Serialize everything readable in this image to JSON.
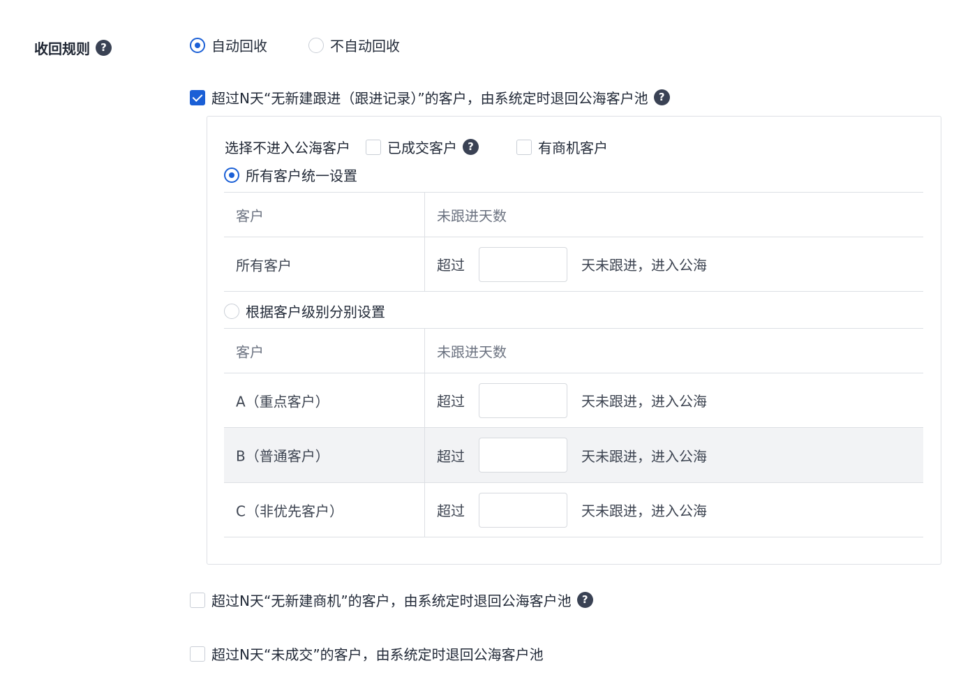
{
  "section": {
    "title": "收回规则",
    "help_icon": "question-circle-icon"
  },
  "recovery_mode": {
    "options": [
      {
        "label": "自动回收",
        "selected": true
      },
      {
        "label": "不自动回收",
        "selected": false
      }
    ]
  },
  "rule_followup": {
    "checked": true,
    "label": "超过N天“无新建跟进（跟进记录）”的客户，由系统定时退回公海客户池",
    "exclude": {
      "label": "选择不进入公海客户",
      "options": [
        {
          "label": "已成交客户",
          "checked": false,
          "has_help": true
        },
        {
          "label": "有商机客户",
          "checked": false,
          "has_help": false
        }
      ]
    },
    "uniform": {
      "label": "所有客户统一设置",
      "selected": true,
      "headers": [
        "客户",
        "未跟进天数"
      ],
      "rows": [
        {
          "customer": "所有客户",
          "prefix": "超过",
          "value": "",
          "suffix": "天未跟进，进入公海"
        }
      ]
    },
    "by_level": {
      "label": "根据客户级别分别设置",
      "selected": false,
      "headers": [
        "客户",
        "未跟进天数"
      ],
      "rows": [
        {
          "customer": "A（重点客户）",
          "prefix": "超过",
          "value": "",
          "suffix": "天未跟进，进入公海"
        },
        {
          "customer": "B（普通客户）",
          "prefix": "超过",
          "value": "",
          "suffix": "天未跟进，进入公海"
        },
        {
          "customer": "C（非优先客户）",
          "prefix": "超过",
          "value": "",
          "suffix": "天未跟进，进入公海"
        }
      ]
    }
  },
  "rule_opportunity": {
    "checked": false,
    "label": "超过N天“无新建商机”的客户，由系统定时退回公海客户池"
  },
  "rule_deal": {
    "checked": false,
    "label": "超过N天“未成交”的客户，由系统定时退回公海客户池"
  },
  "colors": {
    "primary": "#1a5fd6",
    "border": "#dcdfe4",
    "shaded_row": "#f2f3f5",
    "help_icon_bg": "#3a4254"
  }
}
